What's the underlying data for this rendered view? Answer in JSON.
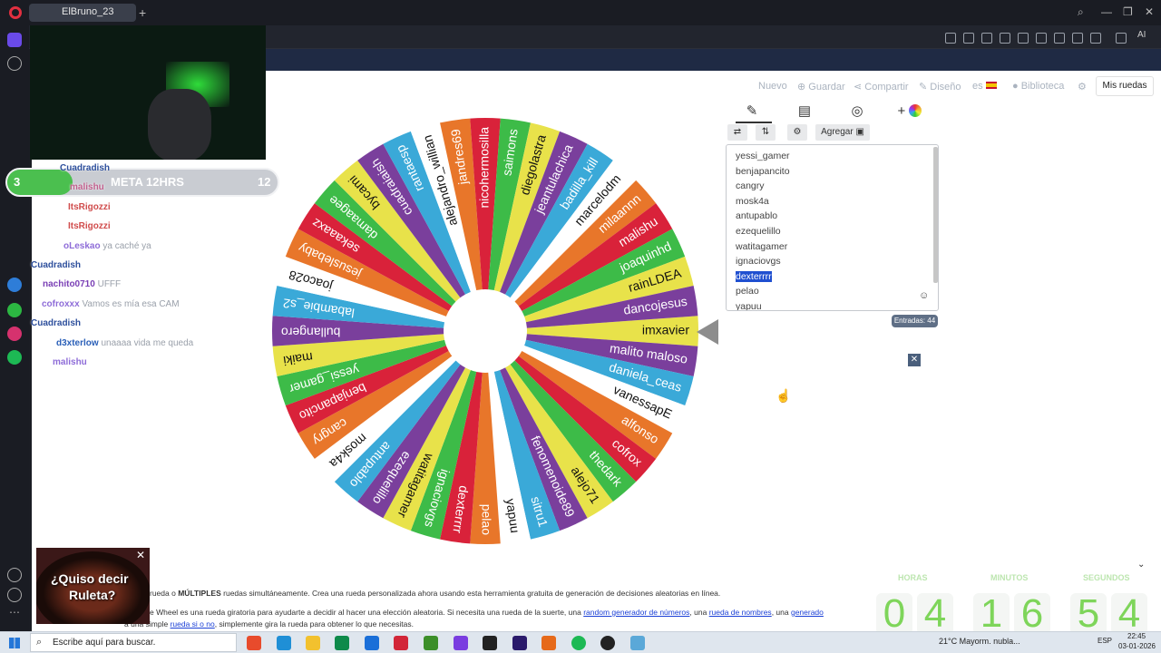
{
  "browser": {
    "tab_title": "ElBruno_23",
    "extra_tab_icon": "plus-icon"
  },
  "wheel_app": {
    "toolbar": {
      "nuevo": "Nuevo",
      "guardar": "Guardar",
      "compartir": "Compartir",
      "diseno": "Diseño",
      "lang": "es",
      "biblioteca": "Biblioteca",
      "mis_ruedas": "Mis ruedas"
    },
    "actions": {
      "agregar": "Agregar"
    },
    "entries": [
      "yessi_gamer",
      "benjapancito",
      "cangry",
      "mosk4a",
      "antupablo",
      "ezequelillo",
      "watitagamer",
      "ignaciovgs",
      "dexterrrr",
      "pelao",
      "yapuu"
    ],
    "selected_entry": "dexterrrr",
    "entry_count": "Entradas: 44",
    "wheel_colors": [
      "#e8e24a",
      "#7a3f9c",
      "#3aa9d8",
      "#ffffff",
      "#e8762a",
      "#d9223a",
      "#3dbb48"
    ],
    "wheel_names": [
      "imxavier",
      "malito maloso",
      "daniela_ceas",
      "vanessapE",
      "alfonso",
      "cofrox",
      "thedark",
      "alejo71",
      "fenomenoide89",
      "sitru1",
      "yapuu",
      "pelao",
      "dexterrrr",
      "ignaciovgs",
      "watitagamer",
      "ezequelillo",
      "antupablo",
      "mosk4a",
      "cangry",
      "benjapancito",
      "yessi_gamer",
      "maiki",
      "bullangero",
      "labambie_s2",
      "joaco28",
      "jesuslebaby",
      "sekaaaxz",
      "damaagee",
      "bycami",
      "cuadraiaish",
      "rantaesp",
      "alejandro_willian",
      "jandres69",
      "nicohermosilla",
      "saimons",
      "diegolastra",
      "jeantulachica",
      "badilla_kill",
      "marcelodm",
      "milaannn",
      "malishu",
      "joaquinhd",
      "rainLDEA",
      "dancojesus"
    ]
  },
  "description": {
    "line1_prefix": "rueda o",
    "line1_bold": "MÚLTIPLES",
    "line1_rest": "ruedas simultáneamente. Crea una rueda personalizada ahora usando esta herramienta gratuita de generación de decisiones aleatorias en línea.",
    "line2_start": "e Wheel es una rueda giratoria para ayudarte a decidir al hacer una elección aleatoria. Si necesita una rueda de la suerte, una",
    "link1": "random generador de números",
    "link2": "rueda de nombres",
    "link3": "generado",
    "line3_start": "a una simple",
    "link4": "rueda si o no",
    "line3_end": ", simplemente gira la rueda para obtener lo que necesitas."
  },
  "overlay": {
    "meta_left": "3",
    "meta_title": "META 12HRS",
    "meta_right": "12",
    "chat": [
      {
        "user": "Cuadradish",
        "msg": ""
      },
      {
        "user": "malishu",
        "msg": ""
      },
      {
        "user": "ItsRigozzi",
        "msg": ""
      },
      {
        "user": "ItsRigozzi",
        "msg": ""
      },
      {
        "user": "oLeskao",
        "msg": "ya caché ya"
      },
      {
        "user": "Cuadradish",
        "msg": ""
      },
      {
        "user": "nachito0710",
        "msg": "UFFF"
      },
      {
        "user": "cofroxxx",
        "msg": "Vamos es mía esa CAM"
      },
      {
        "user": "Cuadradish",
        "msg": ""
      },
      {
        "user": "d3xterlow",
        "msg": "unaaaa vida me queda"
      },
      {
        "user": "malishu",
        "msg": ""
      }
    ],
    "ad_text_1": "¿Quiso decir",
    "ad_text_2": "Ruleta?",
    "timer": {
      "labels": [
        "HORAS",
        "MINUTOS",
        "SEGUNDOS"
      ],
      "digits": [
        "0",
        "4",
        "1",
        "6",
        "5",
        "4"
      ]
    }
  },
  "taskbar": {
    "search_placeholder": "Escribe aquí para buscar.",
    "weather": "21°C  Mayorm. nubla...",
    "lang": "ESP",
    "time": "22:45",
    "date": "03-01-2026"
  }
}
